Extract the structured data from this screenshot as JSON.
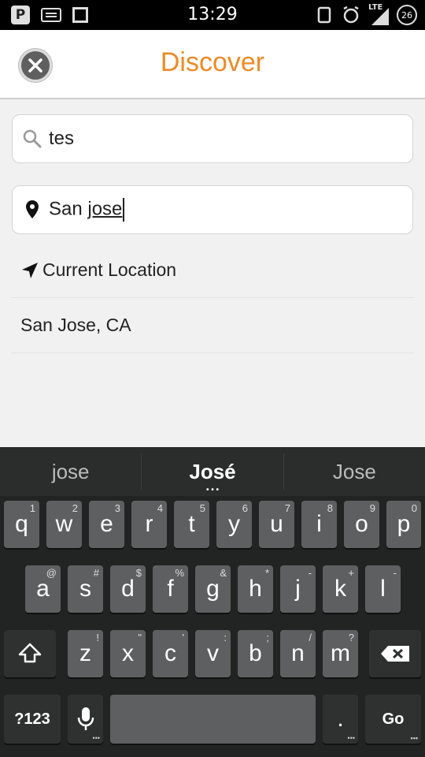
{
  "status_bar": {
    "time": "13:29",
    "network": "LTE",
    "battery": "26"
  },
  "header": {
    "title": "Discover"
  },
  "search": {
    "value": "tes"
  },
  "location": {
    "value_prefix": "San ",
    "value_underlined": "jose"
  },
  "suggestions": {
    "current_location": "Current Location",
    "san_jose": "San Jose, CA"
  },
  "keyboard": {
    "word_suggestions": [
      "jose",
      "José",
      "Jose"
    ],
    "row1": [
      {
        "label": "q",
        "hint": "1"
      },
      {
        "label": "w",
        "hint": "2"
      },
      {
        "label": "e",
        "hint": "3"
      },
      {
        "label": "r",
        "hint": "4"
      },
      {
        "label": "t",
        "hint": "5"
      },
      {
        "label": "y",
        "hint": "6"
      },
      {
        "label": "u",
        "hint": "7"
      },
      {
        "label": "i",
        "hint": "8"
      },
      {
        "label": "o",
        "hint": "9"
      },
      {
        "label": "p",
        "hint": "0"
      }
    ],
    "row2": [
      {
        "label": "a",
        "hint": "@"
      },
      {
        "label": "s",
        "hint": "#"
      },
      {
        "label": "d",
        "hint": "$"
      },
      {
        "label": "f",
        "hint": "%"
      },
      {
        "label": "g",
        "hint": "&"
      },
      {
        "label": "h",
        "hint": "*"
      },
      {
        "label": "j",
        "hint": "-"
      },
      {
        "label": "k",
        "hint": "+"
      },
      {
        "label": "l",
        "hint": "-"
      }
    ],
    "row3": [
      {
        "label": "z",
        "hint": "!"
      },
      {
        "label": "x",
        "hint": "\""
      },
      {
        "label": "c",
        "hint": "'"
      },
      {
        "label": "v",
        "hint": ":"
      },
      {
        "label": "b",
        "hint": ";"
      },
      {
        "label": "n",
        "hint": "/"
      },
      {
        "label": "m",
        "hint": "?"
      }
    ],
    "symbols_label": "?123",
    "period_label": ".",
    "go_label": "Go"
  },
  "colors": {
    "title_accent": "#f08a24",
    "keyboard_bg": "#222323",
    "key_bg": "#5e5f60"
  }
}
